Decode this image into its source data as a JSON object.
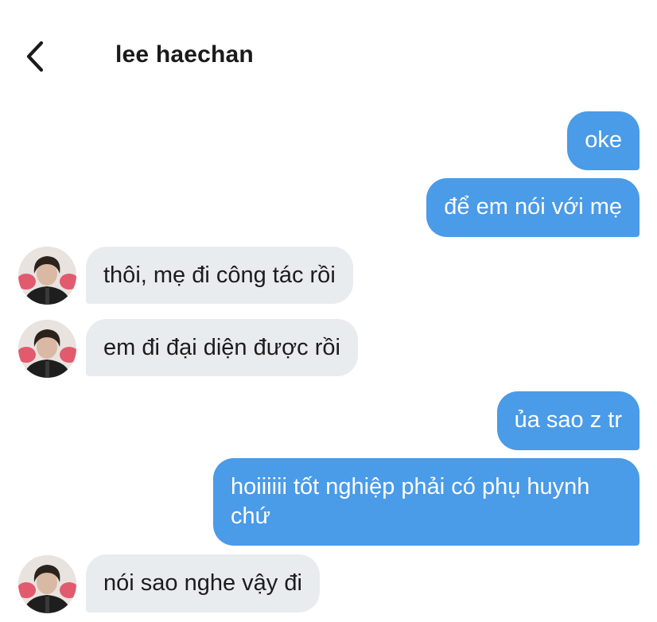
{
  "header": {
    "back_icon": "chevron-left-icon",
    "title": "lee haechan"
  },
  "colors": {
    "outgoing_bubble": "#4a9be8",
    "incoming_bubble": "#e9ecef",
    "background": "#ffffff"
  },
  "messages": [
    {
      "direction": "outgoing",
      "text": "oke"
    },
    {
      "direction": "outgoing",
      "text": "để em nói với mẹ"
    },
    {
      "direction": "incoming",
      "text": "thôi, mẹ đi công tác rồi"
    },
    {
      "direction": "incoming",
      "text": "em đi đại diện được rồi"
    },
    {
      "direction": "outgoing",
      "text": "ủa sao z tr"
    },
    {
      "direction": "outgoing",
      "text": "hoiiiiii tốt nghiệp phải có phụ huynh chứ"
    },
    {
      "direction": "incoming",
      "text": "nói sao nghe vậy đi"
    }
  ]
}
